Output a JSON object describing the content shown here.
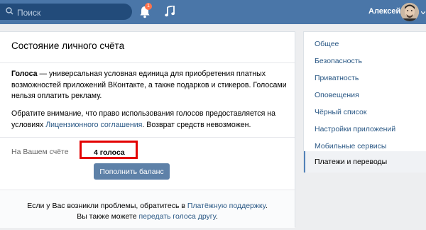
{
  "topbar": {
    "search_placeholder": "Поиск",
    "notification_count": "1",
    "username": "Алексей"
  },
  "card": {
    "title": "Состояние личного счёта",
    "intro_bold": "Голоса",
    "intro_rest": " — универсальная условная единица для приобретения платных возможностей приложений ВКонтакте, а также подарков и стикеров. Голосами нельзя оплатить рекламу.",
    "notice_start": "Обратите внимание, что право использования голосов предоставляется на условиях ",
    "license_link": "Лицензионного соглашения",
    "notice_end": ". Возврат средств невозможен.",
    "account_label": "На Вашем счёте",
    "account_value": "4 голоса",
    "topup_button": "Пополнить баланс",
    "footer_line1_start": "Если у Вас возникли проблемы, обратитесь в ",
    "footer_support_link": "Платёжную поддержку",
    "footer_line1_end": ".",
    "footer_line2_start": "Вы также можете ",
    "footer_transfer_link": "передать голоса другу",
    "footer_line2_end": "."
  },
  "menu": {
    "items": [
      "Общее",
      "Безопасность",
      "Приватность",
      "Оповещения",
      "Чёрный список",
      "Настройки приложений",
      "Мобильные сервисы"
    ],
    "active": "Платежи и переводы"
  },
  "colors": {
    "header": "#4a76a8",
    "link": "#2a5885",
    "highlight_border": "#e30000",
    "button": "#5e81a8"
  }
}
